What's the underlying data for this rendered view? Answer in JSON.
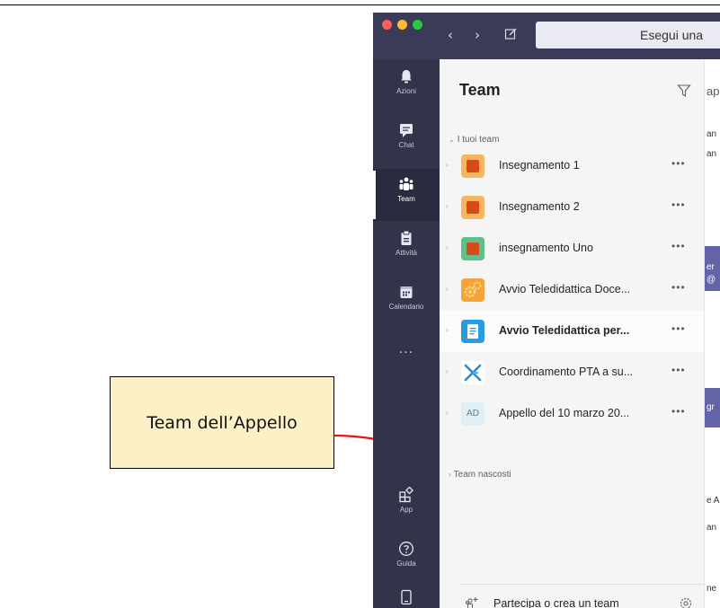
{
  "callout": {
    "label": "Team dell’Appello"
  },
  "window": {
    "search": {
      "text": "Esegui una"
    }
  },
  "rail": {
    "items": [
      {
        "label": "Azioni",
        "icon": "bell-icon"
      },
      {
        "label": "Chat",
        "icon": "chat-icon"
      },
      {
        "label": "Team",
        "icon": "teams-icon",
        "active": true
      },
      {
        "label": "Attività",
        "icon": "assignments-icon"
      },
      {
        "label": "Calendario",
        "icon": "calendar-icon"
      },
      {
        "label": "...",
        "icon": "more-icon"
      },
      {
        "label": "App",
        "icon": "apps-icon"
      },
      {
        "label": "Guida",
        "icon": "help-icon"
      },
      {
        "label": "",
        "icon": "device-icon"
      }
    ]
  },
  "panel": {
    "title": "Team",
    "sections": {
      "your_teams": "I tuoi team",
      "hidden_teams": "Team nascosti"
    },
    "teams": [
      {
        "name": "Insegnamento 1",
        "avatar": "orange-square"
      },
      {
        "name": "Insegnamento 2",
        "avatar": "orange-square"
      },
      {
        "name": "insegnamento Uno",
        "avatar": "green-square"
      },
      {
        "name": "Avvio Teledidattica Doce...",
        "avatar": "gears"
      },
      {
        "name": "Avvio Teledidattica per...",
        "avatar": "document",
        "bold": true
      },
      {
        "name": "Coordinamento PTA a su...",
        "avatar": "x-mark"
      },
      {
        "name": "Appello del 10 marzo 20...",
        "avatar": "AD"
      }
    ],
    "more_label": "•••",
    "join_label": "Partecipa o crea un team"
  },
  "content": {
    "fragments": [
      "ap",
      "an",
      "an",
      "er",
      "@",
      "gr",
      "e A",
      "an",
      "ne"
    ]
  },
  "colors": {
    "titlebar": "#3b3a59",
    "rail": "#33344a",
    "accent": "#6264a7",
    "callout_fill": "#fcf0c7",
    "arrow": "#e8131a"
  }
}
